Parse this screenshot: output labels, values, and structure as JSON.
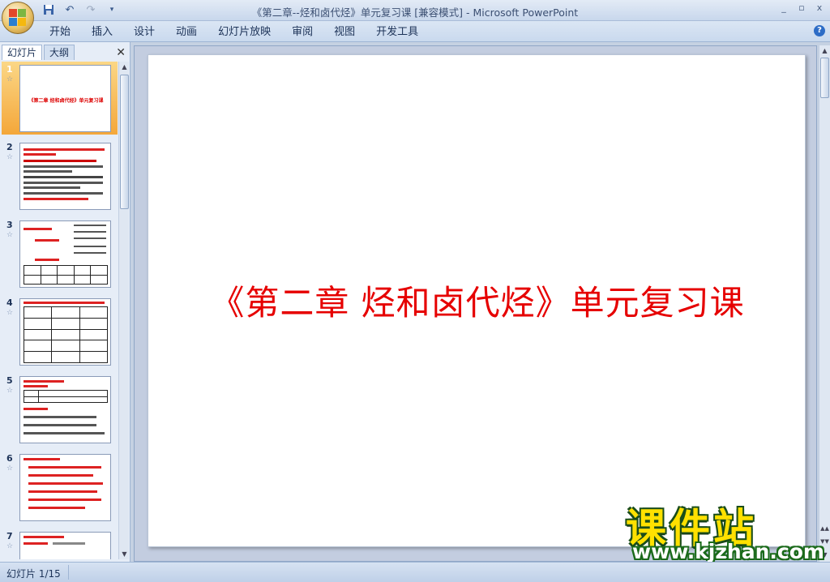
{
  "window": {
    "title": "《第二章--烃和卤代烃》单元复习课 [兼容模式] - Microsoft PowerPoint",
    "controls": [
      "_",
      "▫",
      "x"
    ]
  },
  "ribbon": {
    "tabs": [
      "开始",
      "插入",
      "设计",
      "动画",
      "幻灯片放映",
      "审阅",
      "视图",
      "开发工具"
    ],
    "help": "?"
  },
  "pane": {
    "tabs": [
      "幻灯片",
      "大纲"
    ],
    "close": "✕",
    "slides": [
      {
        "num": "1",
        "selected": true,
        "title": "《第二章 烃和卤代烃》单元复习课"
      },
      {
        "num": "2",
        "selected": false
      },
      {
        "num": "3",
        "selected": false
      },
      {
        "num": "4",
        "selected": false
      },
      {
        "num": "5",
        "selected": false
      },
      {
        "num": "6",
        "selected": false
      },
      {
        "num": "7",
        "selected": false
      }
    ],
    "star": "☆"
  },
  "slide": {
    "title": "《第二章  烃和卤代烃》单元复习课"
  },
  "watermark": {
    "cn": "课件站",
    "url": "www.kjzhan.com"
  },
  "status": {
    "text": "幻灯片 1/15"
  },
  "colors": {
    "title_red": "#e60000",
    "selection": "#f4a73a",
    "watermark_yellow": "#ffe100"
  }
}
